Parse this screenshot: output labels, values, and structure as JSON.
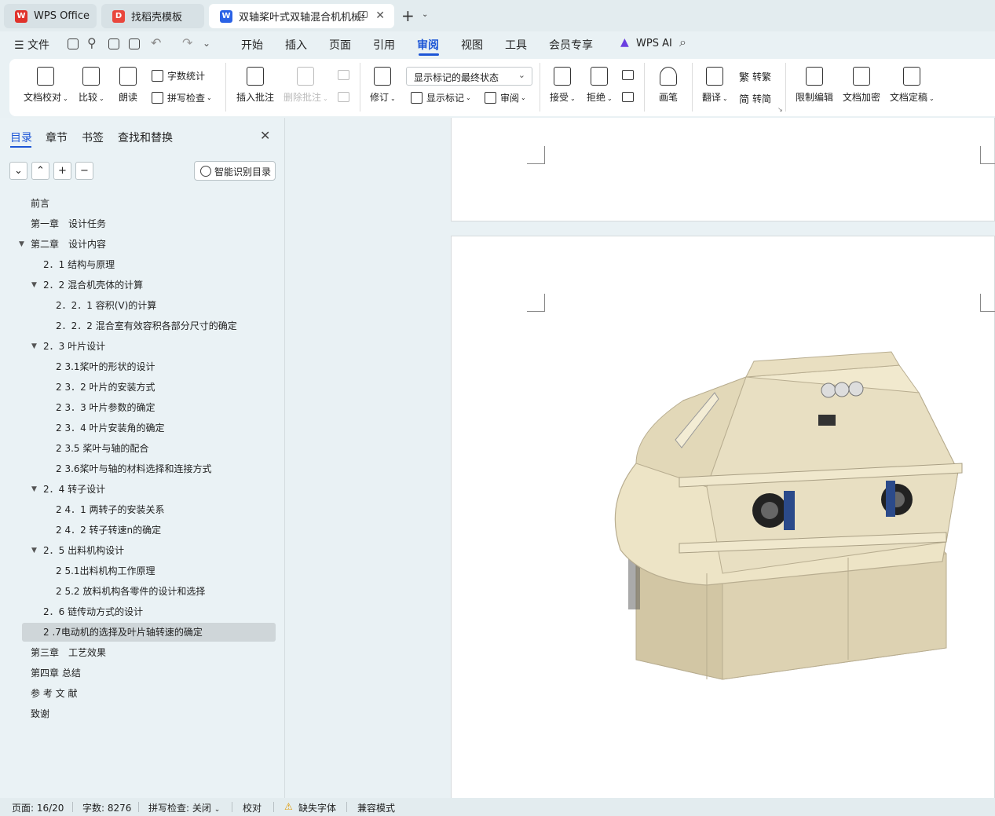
{
  "tabs": [
    {
      "label": "WPS Office",
      "logo": "W",
      "logo_color": "#e0322b",
      "active": false
    },
    {
      "label": "找稻壳模板",
      "logo": "D",
      "logo_color": "#e9473d",
      "active": false
    },
    {
      "label": "双轴桨叶式双轴混合机机械结",
      "logo": "W",
      "logo_color": "#2a62e6",
      "active": true
    }
  ],
  "menu": {
    "file": "文件",
    "items": [
      "开始",
      "插入",
      "页面",
      "引用",
      "审阅",
      "视图",
      "工具",
      "会员专享"
    ],
    "active_index": 4,
    "ai": "WPS AI"
  },
  "ribbon": {
    "doc_check": "文档校对",
    "compare": "比较",
    "read_aloud": "朗读",
    "word_count": "字数统计",
    "spell_check": "拼写检查",
    "insert_comment": "插入批注",
    "delete_comment": "删除批注",
    "revise": "修订",
    "markup_combo": "显示标记的最终状态",
    "show_markup": "显示标记",
    "review_pane": "审阅",
    "accept": "接受",
    "reject": "拒绝",
    "pen": "画笔",
    "translate": "翻译",
    "to_traditional": "转繁",
    "to_simplified": "转简",
    "trad_glyph": "繁",
    "simp_glyph": "简",
    "restrict_edit": "限制编辑",
    "encrypt": "文档加密",
    "finalize": "文档定稿"
  },
  "panel": {
    "tabs": [
      "目录",
      "章节",
      "书签",
      "查找和替换"
    ],
    "smart_toc": "智能识别目录",
    "toc": [
      {
        "text": "前言",
        "level": 0,
        "expanded": null
      },
      {
        "text": "第一章　设计任务",
        "level": 0,
        "expanded": null
      },
      {
        "text": "第二章　设计内容",
        "level": 0,
        "expanded": true
      },
      {
        "text": "2．1  结构与原理",
        "level": 1,
        "expanded": null
      },
      {
        "text": "2．2  混合机壳体的计算",
        "level": 1,
        "expanded": true
      },
      {
        "text": "2．2．1  容积(V)的计算",
        "level": 2,
        "expanded": null
      },
      {
        "text": "2．2．2  混合室有效容积各部分尺寸的确定",
        "level": 2,
        "expanded": null
      },
      {
        "text": "2．3  叶片设计",
        "level": 1,
        "expanded": true
      },
      {
        "text": "2 3.1桨叶的形状的设计",
        "level": 2,
        "expanded": null
      },
      {
        "text": "2 3．2  叶片的安装方式",
        "level": 2,
        "expanded": null
      },
      {
        "text": "2 3．3  叶片参数的确定",
        "level": 2,
        "expanded": null
      },
      {
        "text": "2 3．4  叶片安装角的确定",
        "level": 2,
        "expanded": null
      },
      {
        "text": "2 3.5  桨叶与轴的配合",
        "level": 2,
        "expanded": null
      },
      {
        "text": "2 3.6桨叶与轴的材料选择和连接方式",
        "level": 2,
        "expanded": null
      },
      {
        "text": "2．4  转子设计",
        "level": 1,
        "expanded": true
      },
      {
        "text": "2 4．1  两转子的安装关系",
        "level": 2,
        "expanded": null
      },
      {
        "text": "2 4．2  转子转速n的确定",
        "level": 2,
        "expanded": null
      },
      {
        "text": "2．5  出料机构设计",
        "level": 1,
        "expanded": true
      },
      {
        "text": "2 5.1出料机构工作原理",
        "level": 2,
        "expanded": null
      },
      {
        "text": "2 5.2  放料机构各零件的设计和选择",
        "level": 2,
        "expanded": null
      },
      {
        "text": "2．6  链传动方式的设计",
        "level": 1,
        "expanded": null
      },
      {
        "text": "2 .7电动机的选择及叶片轴转速的确定",
        "level": 1,
        "expanded": null,
        "selected": true
      },
      {
        "text": "第三章　工艺效果",
        "level": 0,
        "expanded": null
      },
      {
        "text": "第四章  总结",
        "level": 0,
        "expanded": null
      },
      {
        "text": "参  考  文  献",
        "level": 0,
        "expanded": null
      },
      {
        "text": "致谢",
        "level": 0,
        "expanded": null
      }
    ]
  },
  "status": {
    "page": "页面: 16/20",
    "words": "字数: 8276",
    "spell": "拼写检查: 关闭",
    "proof": "校对",
    "missing_font": "缺失字体",
    "compat": "兼容模式"
  },
  "colors": {
    "accent": "#1d56d6",
    "mixer_body": "#ede4c6",
    "bearing": "#2b4a8a"
  }
}
